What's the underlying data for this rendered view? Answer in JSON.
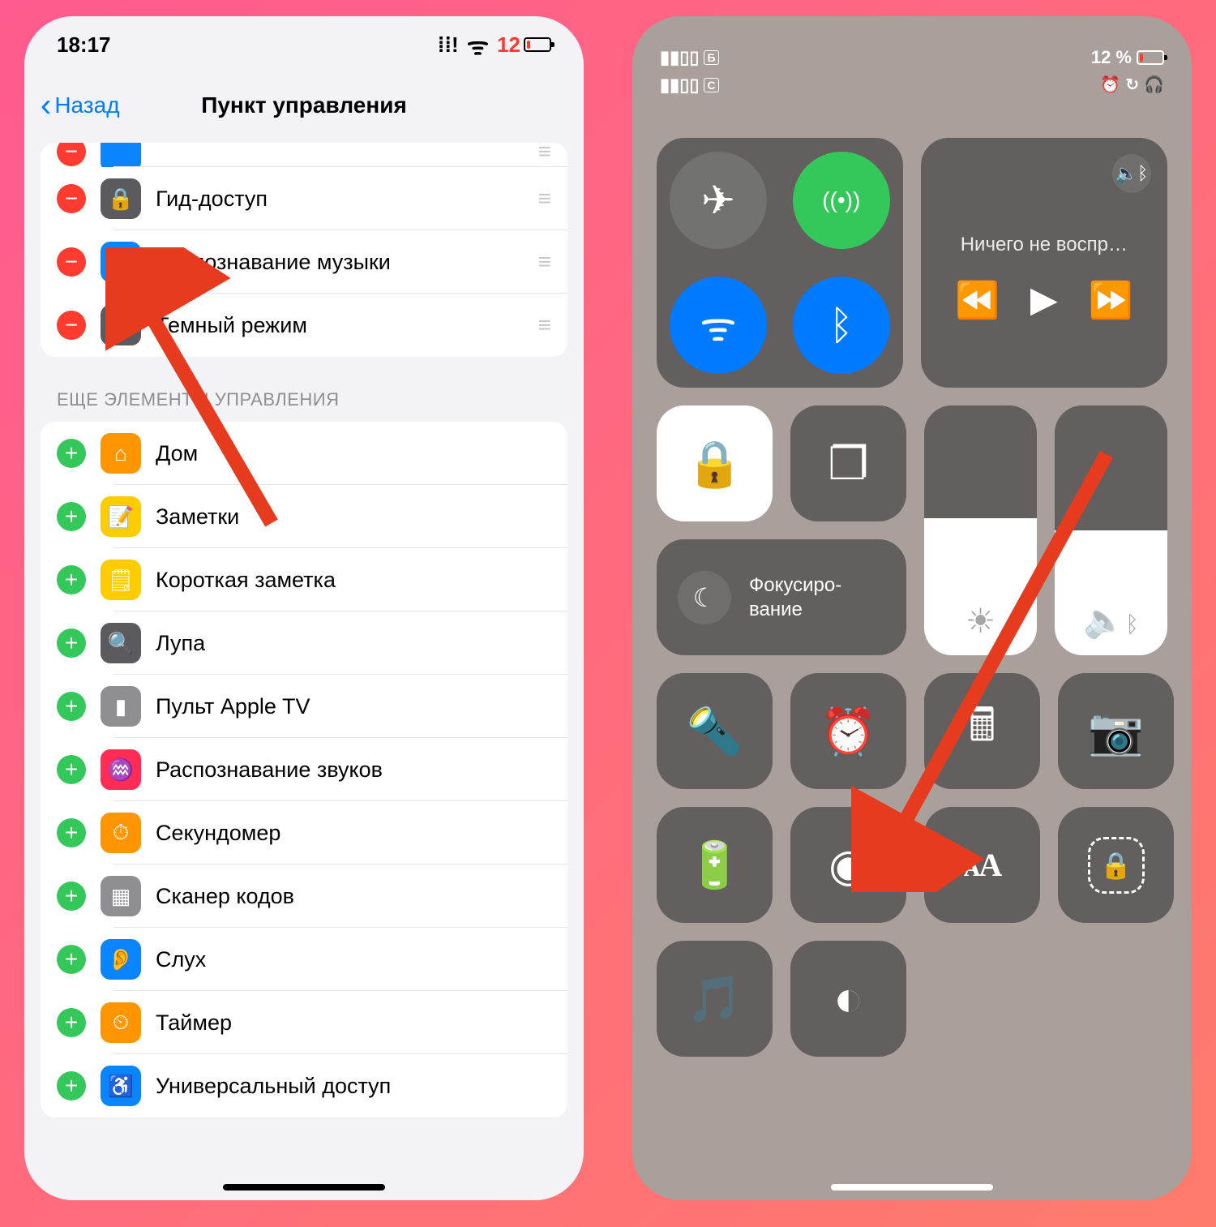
{
  "left": {
    "status": {
      "time": "18:17",
      "battery_percent": "12"
    },
    "nav": {
      "back": "Назад",
      "title": "Пункт управления"
    },
    "included": [
      {
        "id": "guided",
        "label": "Гид-доступ",
        "icon": "lock-rect-icon",
        "bg": "#5a5a5f"
      },
      {
        "id": "shazam",
        "label": "Распознавание музыки",
        "icon": "shazam-icon",
        "bg": "#0a84ff"
      },
      {
        "id": "dark",
        "label": "Темный режим",
        "icon": "half-circle-icon",
        "bg": "#5a5a5f"
      }
    ],
    "more_header": "ЕЩЕ ЭЛЕМЕНТЫ УПРАВЛЕНИЯ",
    "more": [
      {
        "id": "home",
        "label": "Дом",
        "icon": "home-icon",
        "bg": "#ff9500"
      },
      {
        "id": "notes",
        "label": "Заметки",
        "icon": "notes-icon",
        "bg": "#ffcc00"
      },
      {
        "id": "quicknote",
        "label": "Короткая заметка",
        "icon": "quicknote-icon",
        "bg": "#ffcc00"
      },
      {
        "id": "magnifier",
        "label": "Лупа",
        "icon": "magnifier-icon",
        "bg": "#5a5a5f"
      },
      {
        "id": "appletv",
        "label": "Пульт Apple TV",
        "icon": "remote-icon",
        "bg": "#8e8e93"
      },
      {
        "id": "soundrec",
        "label": "Распознавание звуков",
        "icon": "wave-icon",
        "bg": "#ff2d55"
      },
      {
        "id": "stopwatch",
        "label": "Секундомер",
        "icon": "stopwatch-icon",
        "bg": "#ff9500"
      },
      {
        "id": "scanner",
        "label": "Сканер кодов",
        "icon": "qr-icon",
        "bg": "#8e8e93"
      },
      {
        "id": "hearing",
        "label": "Слух",
        "icon": "ear-icon",
        "bg": "#0a84ff"
      },
      {
        "id": "timer",
        "label": "Таймер",
        "icon": "timer-icon",
        "bg": "#ff9500"
      },
      {
        "id": "access",
        "label": "Универсальный доступ",
        "icon": "accessibility-icon",
        "bg": "#0a84ff"
      }
    ]
  },
  "right": {
    "status": {
      "sim1": "Б",
      "sim2": "С",
      "battery_text": "12 %"
    },
    "media": {
      "title": "Ничего не воспр…"
    },
    "focus": {
      "label": "Фокусиро-\nвание"
    }
  },
  "icon_glyphs": {
    "lock-rect-icon": "🔒",
    "shazam-icon": "🎵",
    "half-circle-icon": "◐",
    "home-icon": "⌂",
    "notes-icon": "📝",
    "quicknote-icon": "🗒",
    "magnifier-icon": "🔍",
    "remote-icon": "▮",
    "wave-icon": "♒",
    "stopwatch-icon": "⏱",
    "qr-icon": "▦",
    "ear-icon": "👂",
    "timer-icon": "⏲",
    "accessibility-icon": "♿",
    "airplane-icon": "✈",
    "cellular-icon": "((•))",
    "wifi-icon": "ᯤ",
    "bluetooth-icon": "ᛒ",
    "back-icon": "⟲",
    "play-icon": "▶",
    "fwd-icon": "⏩",
    "rev-icon": "⏪",
    "lock-rotation-icon": "🔒",
    "mirror-icon": "❐",
    "moon-icon": "☾",
    "flashlight-icon": "🔦",
    "alarm-clock-icon": "⏰",
    "calculator-icon": "🖩",
    "camera-icon": "📷",
    "battery-icon": "🔋",
    "record-icon": "◉",
    "brightness-icon": "☀",
    "volume-icon": "🔈",
    "headphones-icon": "🎧",
    "alarm-mini-icon": "⏰",
    "rot-mini-icon": "↻",
    "bt-vol-icon": "ᛒ"
  }
}
